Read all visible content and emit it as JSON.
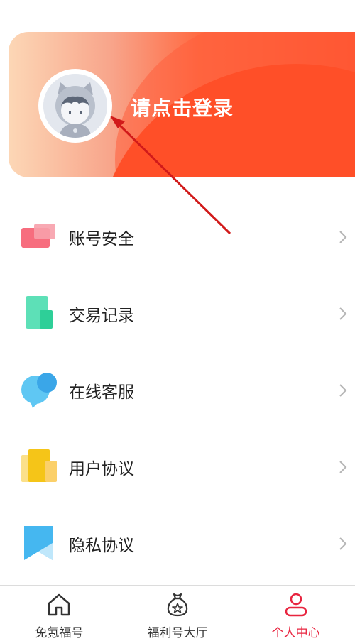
{
  "header": {
    "login_text": "请点击登录"
  },
  "menu": {
    "items": [
      {
        "label": "账号安全",
        "icon": "account-security-icon"
      },
      {
        "label": "交易记录",
        "icon": "transaction-record-icon"
      },
      {
        "label": "在线客服",
        "icon": "customer-service-icon"
      },
      {
        "label": "用户协议",
        "icon": "user-agreement-icon"
      },
      {
        "label": "隐私协议",
        "icon": "privacy-policy-icon"
      }
    ]
  },
  "tabbar": {
    "tabs": [
      {
        "label": "免氪福号",
        "icon": "home-icon",
        "active": false
      },
      {
        "label": "福利号大厅",
        "icon": "bag-star-icon",
        "active": false
      },
      {
        "label": "个人中心",
        "icon": "user-icon",
        "active": true
      }
    ]
  },
  "colors": {
    "accent": "#ff4e28",
    "tab_active": "#e8243f",
    "annotation_arrow": "#d11a1a"
  }
}
